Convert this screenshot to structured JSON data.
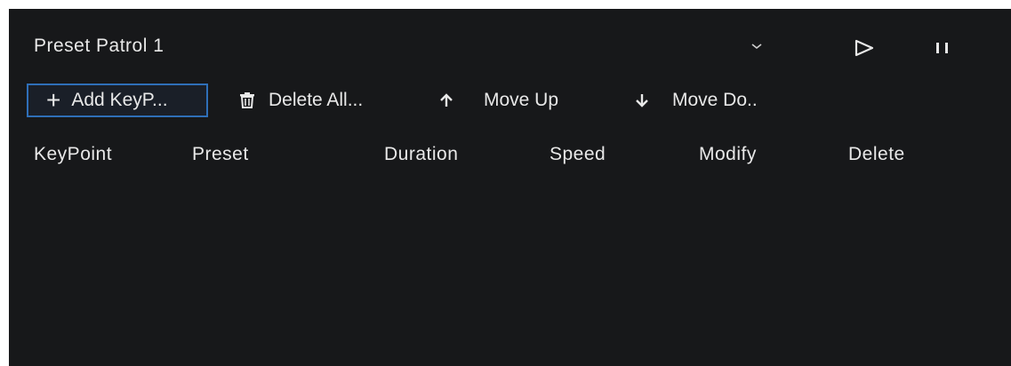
{
  "patrol": {
    "selected": "Preset Patrol 1"
  },
  "toolbar": {
    "add_label": "Add KeyP...",
    "delete_all_label": "Delete All...",
    "move_up_label": "Move Up",
    "move_down_label": "Move Do.."
  },
  "table": {
    "columns": [
      "KeyPoint",
      "Preset",
      "Duration",
      "Speed",
      "Modify",
      "Delete"
    ],
    "rows": []
  },
  "icons": {
    "dropdown": "chevron-down-icon",
    "play": "play-icon",
    "pause": "pause-icon",
    "add": "plus-icon",
    "delete_all": "trash-icon",
    "move_up": "arrow-up-icon",
    "move_down": "arrow-down-icon"
  },
  "colors": {
    "background": "#17181a",
    "accent": "#2f6fb8",
    "text": "#e8e8e8"
  }
}
